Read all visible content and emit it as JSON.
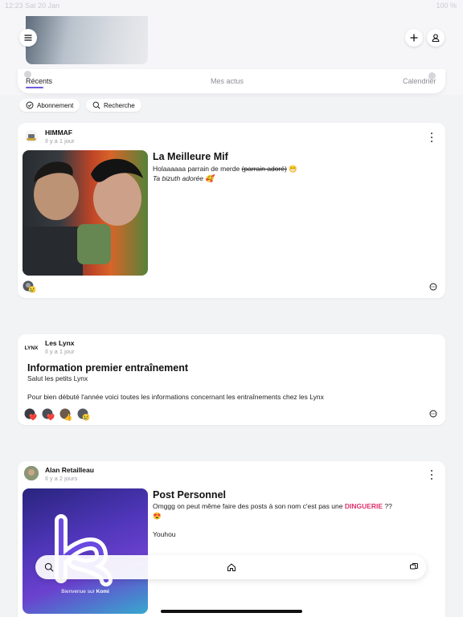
{
  "statusbar": {
    "time": "12:23 Sat 20 Jan",
    "battery": "100 %"
  },
  "tabs": [
    {
      "label": "Récents",
      "active": true
    },
    {
      "label": "Mes actus",
      "active": false
    },
    {
      "label": "Calendrier",
      "active": false
    }
  ],
  "filters": [
    {
      "label": "Abonnement",
      "icon": "check-circle-icon"
    },
    {
      "label": "Recherche",
      "icon": "search-icon"
    }
  ],
  "posts": [
    {
      "author": "HIMMAF",
      "time": "Il y a 1 jour",
      "title": "La Meilleure Mif",
      "line1": "Holaaaaaa parrain de merde",
      "line1_strike": "(parrain adoré)",
      "line1_emoji": "😁",
      "line2": "Ta bizuth adorée 🥰",
      "reaction_emojis": [
        "😢"
      ]
    },
    {
      "author": "Les Lynx",
      "time": "Il y a 1 jour",
      "title": "Information premier entraînement",
      "line1": "Salut les petits Lynx",
      "line2": "Pour bien débuté l'année voici toutes les informations concernant les entraînements chez les Lynx",
      "reaction_emojis": [
        "❤️",
        "❤️",
        "👍",
        "😢"
      ]
    },
    {
      "author": "Alan Retailleau",
      "time": "Il y a 2 jours",
      "title": "Post Personnel",
      "line1": "Omggg on peut même faire des posts à son nom c'est pas une",
      "highlight": "DINGUERIE",
      "line1_end": "??",
      "line2": "😍",
      "line3": "Youhou",
      "image_caption_prefix": "Bienvenue sur",
      "image_caption_brand": "Komi"
    }
  ],
  "colors": {
    "accent": "#6a5ae0",
    "highlight": "#e0306e",
    "background": "#f2f3f5"
  }
}
